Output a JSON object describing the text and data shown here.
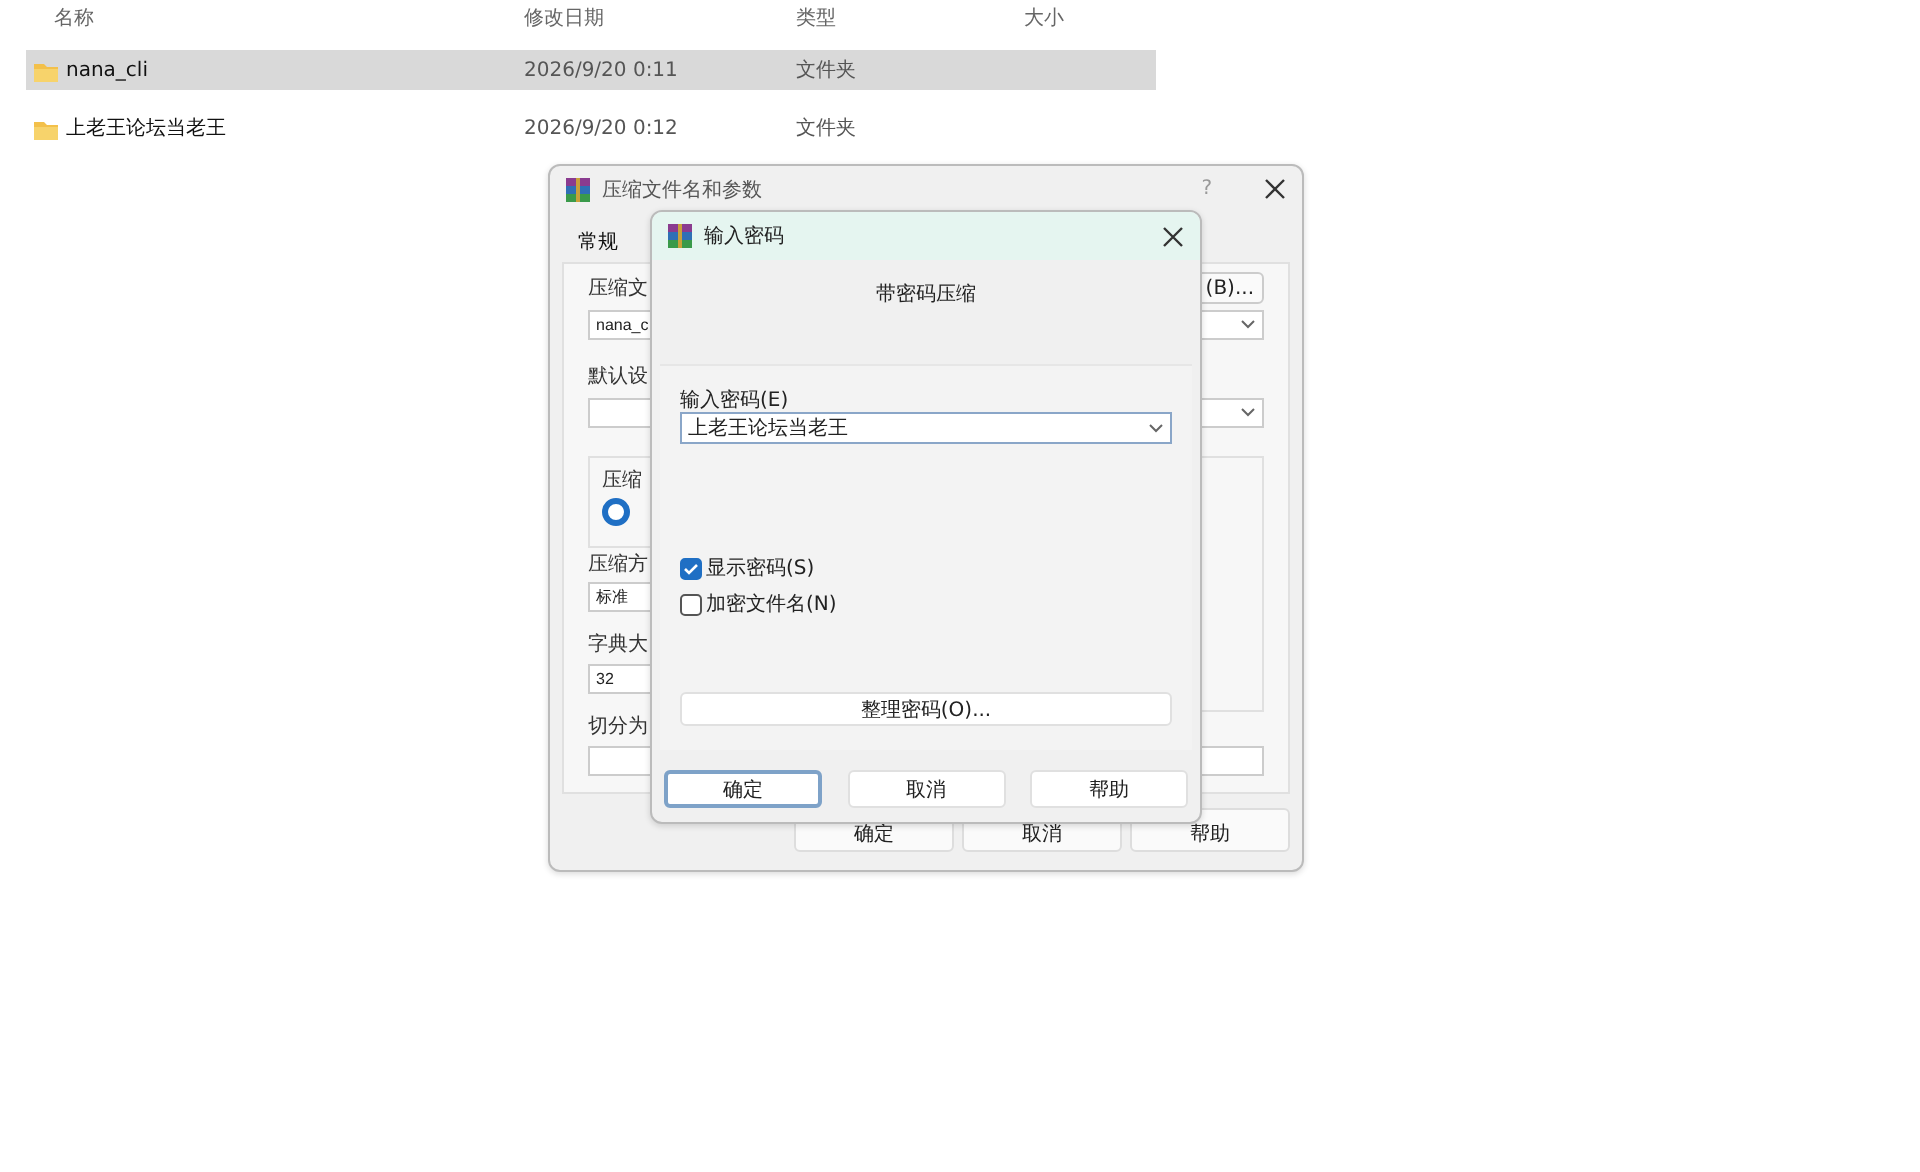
{
  "explorer": {
    "columns": [
      "名称",
      "修改日期",
      "类型",
      "大小"
    ],
    "rows": [
      {
        "name": "nana_cli",
        "modified": "2026/9/20 0:11",
        "type": "文件夹",
        "selected": true
      },
      {
        "name": "上老王论坛当老王",
        "modified": "2026/9/20 0:12",
        "type": "文件夹",
        "selected": false
      }
    ]
  },
  "archive_dialog": {
    "title": "压缩文件名和参数",
    "help": "?",
    "tabs": [
      {
        "label": "常规",
        "selected": true
      }
    ],
    "browse_button": "(B)...",
    "items": [
      {
        "kind": "label",
        "text": "压缩文"
      },
      {
        "kind": "combo",
        "value": "nana_c"
      },
      {
        "kind": "label",
        "text": "默认设"
      },
      {
        "kind": "combo",
        "value": ""
      },
      {
        "kind": "group",
        "text": "压缩",
        "checked": true
      },
      {
        "kind": "label",
        "text": "压缩方"
      },
      {
        "kind": "field",
        "value": "标准"
      },
      {
        "kind": "label",
        "text": "字典大"
      },
      {
        "kind": "field",
        "value": "32"
      },
      {
        "kind": "label",
        "text": "切分为"
      },
      {
        "kind": "wide",
        "value": ""
      }
    ],
    "buttons": [
      "确定",
      "取消",
      "帮助"
    ]
  },
  "password_dialog": {
    "title": "输入密码",
    "heading": "带密码压缩",
    "password_label": "输入密码(E)",
    "password_value": "上老王论坛当老王",
    "checkboxes": [
      {
        "label": "显示密码(S)",
        "checked": true
      },
      {
        "label": "加密文件名(N)",
        "checked": false
      }
    ],
    "organize_button": "整理密码(O)...",
    "buttons": [
      {
        "label": "确定",
        "focused": true
      },
      {
        "label": "取消",
        "focused": false
      },
      {
        "label": "帮助",
        "focused": false
      }
    ]
  }
}
